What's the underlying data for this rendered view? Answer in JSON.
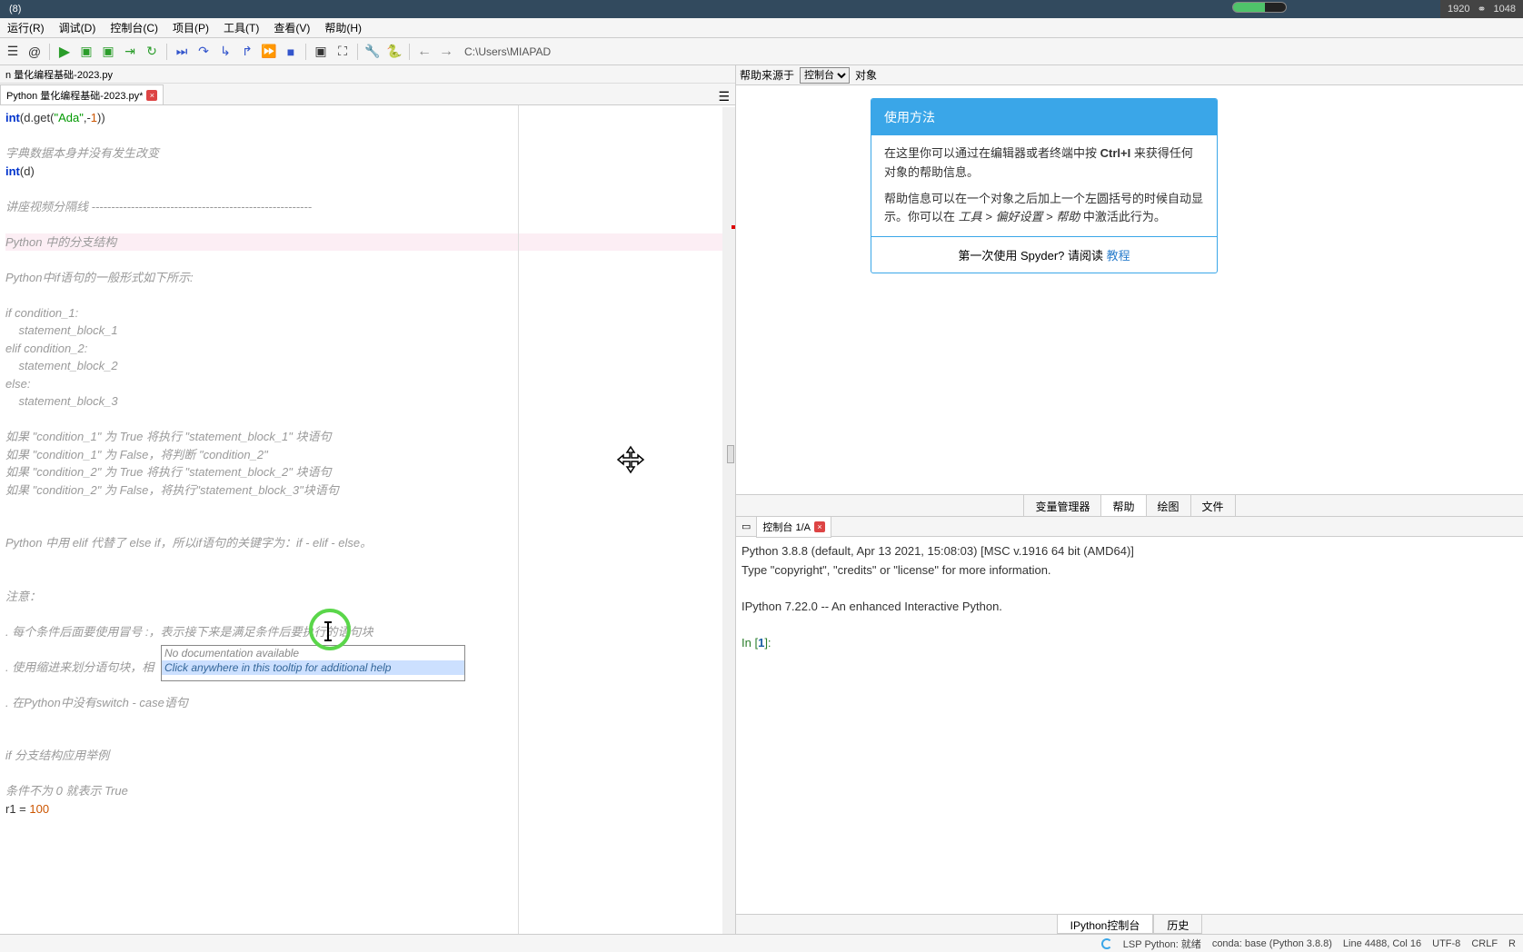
{
  "titlebar": {
    "label_right": "(8)",
    "res_w": "1920",
    "res_h": "1048"
  },
  "menu": {
    "m1": "运行(R)",
    "m2": "调试(D)",
    "m3": "控制台(C)",
    "m4": "项目(P)",
    "m5": "工具(T)",
    "m6": "查看(V)",
    "m7": "帮助(H)"
  },
  "toolbar": {
    "path": "C:\\Users\\MIAPAD"
  },
  "editor": {
    "filepath": "n 量化编程基础-2023.py",
    "tabname": "Python 量化编程基础-2023.py*"
  },
  "code": {
    "l1a": "int",
    "l1b": "(d.get(",
    "l1c": "\"Ada\"",
    "l1d": ",-",
    "l1e": "1",
    "l1f": "))",
    "l3": "字典数据本身并没有发生改变",
    "l4a": "int",
    "l4b": "(d)",
    "l6": "讲座视频分隔线 --------------------------------------------------------",
    "l8": "Python 中的分支结构",
    "l10": "Python中if语句的一般形式如下所示:",
    "l12": "if condition_1:",
    "l13": "    statement_block_1",
    "l14": "elif condition_2:",
    "l15": "    statement_block_2",
    "l16": "else:",
    "l17": "    statement_block_3",
    "l19": "如果 \"condition_1\" 为 True 将执行 \"statement_block_1\" 块语句",
    "l20": "如果 \"condition_1\" 为 False，将判断 \"condition_2\"",
    "l21": "如果 \"condition_2\" 为 True 将执行 \"statement_block_2\" 块语句",
    "l22": "如果 \"condition_2\" 为 False，将执行\"statement_block_3\"块语句",
    "l25": "Python 中用 elif 代替了 else if，所以if语句的关键字为：if - elif - else。",
    "l28": "注意：",
    "l30": ". 每个条件后面要使用冒号 :，表示接下来是满足条件后要执行的语句块",
    "l32": ". 使用缩进来划分语句块，相",
    "l34": ". 在Python中没有switch - case语句",
    "l37": "if 分支结构应用举例",
    "l39": "条件不为 0 就表示 True",
    "l40a": "r1 = ",
    "l40b": "100"
  },
  "tooltip": {
    "t1": "No documentation available",
    "t2": "Click anywhere in this tooltip for additional help"
  },
  "help": {
    "src_label": "帮助来源于",
    "src_val": "控制台",
    "obj_label": "对象",
    "card_title": "使用方法",
    "card_p1a": "在这里你可以通过在编辑器或者终端中按 ",
    "card_p1b": "Ctrl+I",
    "card_p1c": " 来获得任何对象的帮助信息。",
    "card_p2a": "帮助信息可以在一个对象之后加上一个左圆括号的时候自动显示。你可以在 ",
    "card_p2b": "工具 > 偏好设置 > 帮助",
    "card_p2c": " 中激活此行为。",
    "card_f1": "第一次使用 Spyder? 请阅读 ",
    "card_f2": "教程",
    "tab1": "变量管理器",
    "tab2": "帮助",
    "tab3": "绘图",
    "tab4": "文件"
  },
  "console": {
    "tab": "控制台 1/A",
    "l1": "Python 3.8.8 (default, Apr 13 2021, 15:08:03) [MSC v.1916 64 bit (AMD64)]",
    "l2": "Type \"copyright\", \"credits\" or \"license\" for more information.",
    "l4": "IPython 7.22.0 -- An enhanced Interactive Python.",
    "prompt_a": "In [",
    "prompt_n": "1",
    "prompt_b": "]:",
    "btab1": "IPython控制台",
    "btab2": "历史"
  },
  "status": {
    "lsp": "LSP Python: 就绪",
    "conda": "conda: base (Python 3.8.8)",
    "pos": "Line 4488, Col 16",
    "enc": "UTF-8",
    "eol": "CRLF",
    "rw": "R",
    "spin": "✓"
  }
}
